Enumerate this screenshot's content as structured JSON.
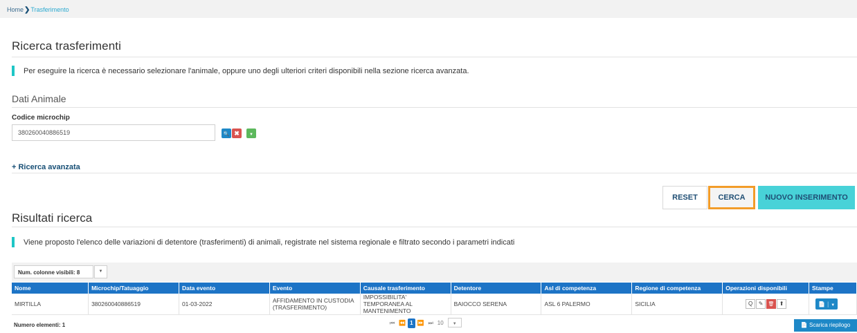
{
  "breadcrumb": {
    "home": "Home",
    "separator": "❯",
    "current": "Trasferimento"
  },
  "page_title": "Ricerca trasferimenti",
  "search_info": "Per eseguire la ricerca è necessario selezionare l'animale, oppure uno degli ulteriori criteri disponibili nella sezione ricerca avanzata.",
  "dati_animale": {
    "title": "Dati Animale",
    "microchip_label": "Codice microchip",
    "microchip_value": "380260040886519"
  },
  "advanced_search_label": "+ Ricerca avanzata",
  "actions": {
    "reset": "RESET",
    "cerca": "CERCA",
    "nuovo": "NUOVO INSERIMENTO"
  },
  "results": {
    "title": "Risultati ricerca",
    "info": "Viene proposto l'elenco delle variazioni di detentore (trasferimenti) di animali, registrate nel sistema regionale e filtrato secondo i parametri indicati",
    "columns_selector": "Num. colonne visibili: 8",
    "headers": [
      "Nome",
      "Microchip/Tatuaggio",
      "Data evento",
      "Evento",
      "Causale trasferimento",
      "Detentore",
      "Asl di competenza",
      "Regione di competenza",
      "Operazioni disponibili",
      "Stampe"
    ],
    "row": {
      "nome": "MIRTILLA",
      "microchip": "380260040886519",
      "data_evento": "01-03-2022",
      "evento": "AFFIDAMENTO IN CUSTODIA (TRASFERIMENTO)",
      "causale": "IMPOSSIBILITA' TEMPORANEA AL MANTENIMENTO",
      "detentore": "BAIOCCO SERENA",
      "asl": "ASL 6 PALERMO",
      "regione": "SICILIA"
    },
    "count_label": "Numero elementi: 1",
    "pager": {
      "first": "⏮",
      "prev": "⏪",
      "current": "1",
      "next": "⏩",
      "last": "⏭",
      "page_size": "10"
    },
    "download_label": "Scarica riepilogo"
  },
  "icons": {
    "search": "🔍",
    "clear": "✖",
    "dropdown": "▼",
    "view": "Q",
    "edit": "✎",
    "delete": "🗑",
    "upload": "⬆",
    "document": "📄"
  },
  "colors": {
    "primary": "#1d74c6",
    "accent": "#48d2d8",
    "highlight": "#f29c29",
    "info_bar": "#1ec6c6",
    "danger": "#d9534f",
    "success": "#5cb85c"
  }
}
